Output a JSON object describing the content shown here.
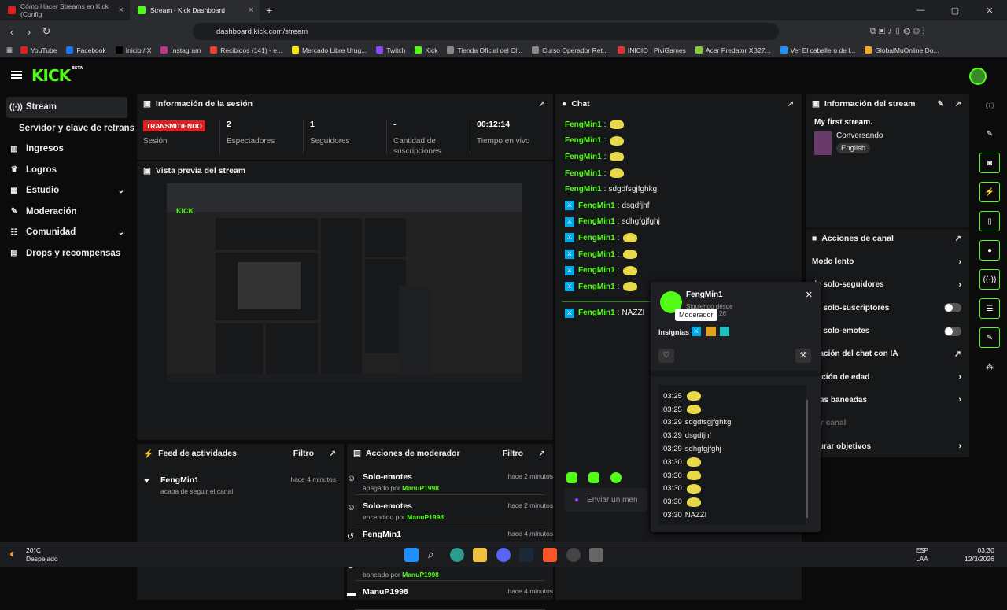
{
  "browser": {
    "tabs": [
      {
        "title": "Cómo Hacer Streams en Kick (Config",
        "active": false
      },
      {
        "title": "Stream - Kick Dashboard",
        "active": true
      }
    ],
    "url": "dashboard.kick.com/stream",
    "bookmarks": [
      "YouTube",
      "Facebook",
      "Inicio / X",
      "Instagram",
      "Recibidos (141) - e...",
      "Mercado Libre Urug...",
      "Twitch",
      "Kick",
      "Tienda Oficial del Cl...",
      "Curso Operador Ret...",
      "INICIO | PiviGames",
      "Acer Predator XB27...",
      "Ver El caballero de l...",
      "GlobalMuOnline Do..."
    ]
  },
  "app": {
    "logo": "KICK",
    "logo_badge": "BETA"
  },
  "sidebar": {
    "items": [
      {
        "label": "Stream",
        "icon": "stream-icon",
        "active": true
      },
      {
        "label": "Servidor y clave de retransmisión",
        "sub": true
      },
      {
        "label": "Ingresos",
        "icon": "chart-icon"
      },
      {
        "label": "Logros",
        "icon": "trophy-icon"
      },
      {
        "label": "Estudio",
        "icon": "grid-icon",
        "chevron": true
      },
      {
        "label": "Moderación",
        "icon": "wrench-icon"
      },
      {
        "label": "Comunidad",
        "icon": "people-icon",
        "chevron": true
      },
      {
        "label": "Drops y recompensas",
        "icon": "gift-icon"
      }
    ]
  },
  "session": {
    "title": "Información de la sesión",
    "live_label": "TRANSMITIENDO",
    "stats": [
      {
        "value": "",
        "label": "Sesión"
      },
      {
        "value": "2",
        "label": "Espectadores"
      },
      {
        "value": "1",
        "label": "Seguidores"
      },
      {
        "value": "-",
        "label": "Cantidad de suscripciones"
      },
      {
        "value": "00:12:14",
        "label": "Tiempo en vivo"
      }
    ]
  },
  "preview": {
    "title": "Vista previa del stream"
  },
  "feed": {
    "title": "Feed de actividades",
    "filter": "Filtro",
    "items": [
      {
        "name": "FengMin1",
        "desc": "acaba de seguir el canal",
        "time": "hace 4 minutos"
      }
    ]
  },
  "modactions": {
    "title": "Acciones de moderador",
    "filter": "Filtro",
    "items": [
      {
        "title": "Solo-emotes",
        "pre": "apagado por",
        "user": "ManuP1998",
        "time": "hace 2 minutos",
        "icon": "smile-icon"
      },
      {
        "title": "Solo-emotes",
        "pre": "encendido por",
        "user": "ManuP1998",
        "time": "hace 2 minutos",
        "icon": "smile-icon"
      },
      {
        "title": "FengMin1",
        "pre": "desbaneado por",
        "user": "ManuP1998",
        "time": "hace 4 minutos",
        "icon": "undo-icon"
      },
      {
        "title": "FengMin1",
        "pre": "baneado por",
        "user": "ManuP1998",
        "time": "hace 4 minutos",
        "icon": "ban-icon"
      },
      {
        "title": "ManuP1998",
        "pre": "",
        "user": "",
        "time": "hace 4 minutos",
        "icon": "hat-icon"
      }
    ]
  },
  "chat": {
    "title": "Chat",
    "input_placeholder": "Enviar un men",
    "messages": [
      {
        "user": "FengMin1",
        "text": "",
        "emote": true,
        "mod": false
      },
      {
        "user": "FengMin1",
        "text": "",
        "emote": true,
        "mod": false
      },
      {
        "user": "FengMin1",
        "text": "",
        "emote": true,
        "mod": false
      },
      {
        "user": "FengMin1",
        "text": "",
        "emote": true,
        "mod": false
      },
      {
        "user": "FengMin1",
        "text": "sdgdfsgjfghkg",
        "emote": false,
        "mod": false
      },
      {
        "user": "FengMin1",
        "text": "dsgdfjhf",
        "emote": false,
        "mod": true
      },
      {
        "user": "FengMin1",
        "text": "sdhgfgjfghj",
        "emote": false,
        "mod": true
      },
      {
        "user": "FengMin1",
        "text": "",
        "emote": true,
        "mod": true
      },
      {
        "user": "FengMin1",
        "text": "",
        "emote": true,
        "mod": true
      },
      {
        "user": "FengMin1",
        "text": "",
        "emote": true,
        "mod": true
      },
      {
        "user": "FengMin1",
        "text": "",
        "emote": true,
        "mod": true
      }
    ],
    "last": {
      "user": "FengMin1",
      "text": "NAZZI"
    }
  },
  "stream_info": {
    "title": "Información del stream",
    "stream_title": "My first stream.",
    "category": "Conversando",
    "language": "English"
  },
  "canal": {
    "title": "Acciones de canal",
    "rows": [
      {
        "label": "Modo lento",
        "type": "chevron"
      },
      {
        "label": "de solo-seguidores",
        "type": "chevron"
      },
      {
        "label": "de solo-suscriptores",
        "type": "toggle"
      },
      {
        "label": "de solo-emotes",
        "type": "toggle"
      },
      {
        "label": "eración del chat con IA",
        "type": "ext"
      },
      {
        "label": "ricción de edad",
        "type": "chevron"
      },
      {
        "label": "oras baneadas",
        "type": "chevron"
      },
      {
        "label": "ear canal",
        "type": "none"
      },
      {
        "label": "igurar objetivos",
        "type": "chevron"
      }
    ]
  },
  "popup": {
    "username": "FengMin1",
    "subtitle_a": "Siguiendo desde",
    "subtitle_b": "26",
    "tooltip": "Moderador",
    "badges_label": "Insignias",
    "history": [
      {
        "time": "03:25",
        "text": "",
        "emote": true
      },
      {
        "time": "03:25",
        "text": "",
        "emote": true
      },
      {
        "time": "03:29",
        "text": "sdgdfsgjfghkg",
        "emote": false
      },
      {
        "time": "03:29",
        "text": "dsgdfjhf",
        "emote": false
      },
      {
        "time": "03:29",
        "text": "sdhgfgjfghj",
        "emote": false
      },
      {
        "time": "03:30",
        "text": "",
        "emote": true
      },
      {
        "time": "03:30",
        "text": "",
        "emote": true
      },
      {
        "time": "03:30",
        "text": "",
        "emote": true
      },
      {
        "time": "03:30",
        "text": "",
        "emote": true
      },
      {
        "time": "03:30",
        "text": "NAZZI",
        "emote": false
      }
    ]
  },
  "taskbar": {
    "temp": "20°C",
    "weather": "Despejado",
    "lang1": "ESP",
    "lang2": "LAA",
    "time": "03:30",
    "date": "12/3/2026"
  },
  "colors": {
    "accent": "#53fc18",
    "live": "#e02020",
    "mod": "#00a8e8"
  }
}
